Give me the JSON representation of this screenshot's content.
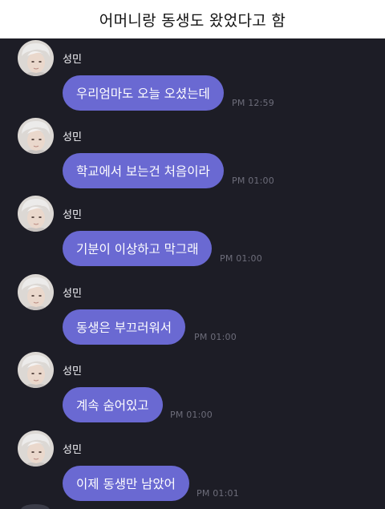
{
  "header": {
    "title": "어머니랑 동생도 왔었다고 함"
  },
  "messages": [
    {
      "sender": "성민",
      "text": "우리엄마도 오늘 오셨는데",
      "time": "PM 12:59"
    },
    {
      "sender": "성민",
      "text": "학교에서 보는건 처음이라",
      "time": "PM 01:00"
    },
    {
      "sender": "성민",
      "text": "기분이 이상하고 막그래",
      "time": "PM 01:00"
    },
    {
      "sender": "성민",
      "text": "동생은 부끄러워서",
      "time": "PM 01:00"
    },
    {
      "sender": "성민",
      "text": "계속 숨어있고",
      "time": "PM 01:00"
    },
    {
      "sender": "성민",
      "text": "이제 동생만 남았어",
      "time": "PM 01:01"
    }
  ],
  "colors": {
    "background": "#1d1d26",
    "bubble": "#6a69d2",
    "timestamp": "#6d6d7a",
    "header_bg": "#ffffff"
  }
}
